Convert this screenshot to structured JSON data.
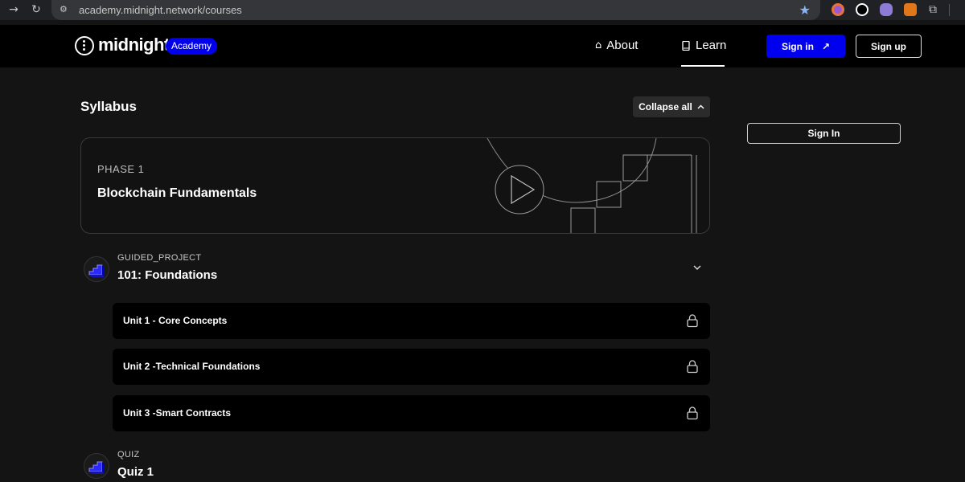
{
  "browser": {
    "url": "academy.midnight.network/courses",
    "back_icon": "arrow-right-icon",
    "reload_icon": "reload-icon"
  },
  "header": {
    "logo_text": "midnight",
    "badge": "Academy",
    "nav": [
      {
        "label": "About",
        "icon": "home-icon"
      },
      {
        "label": "Learn",
        "icon": "book-icon"
      }
    ],
    "sign_in": "Sign in",
    "sign_up": "Sign up",
    "accent": "#0000ee"
  },
  "main": {
    "title": "Syllabus",
    "collapse_label": "Collapse all",
    "side_sign_in": "Sign In",
    "phase": {
      "label": "PHASE 1",
      "title": "Blockchain Fundamentals"
    },
    "modules": [
      {
        "type": "GUIDED_PROJECT",
        "title": "101: Foundations",
        "units": [
          {
            "label": "Unit 1 - Core Concepts"
          },
          {
            "label": "Unit 2 -Technical Foundations"
          },
          {
            "label": "Unit 3 -Smart Contracts"
          }
        ]
      },
      {
        "type": "QUIZ",
        "title": "Quiz 1"
      }
    ]
  }
}
